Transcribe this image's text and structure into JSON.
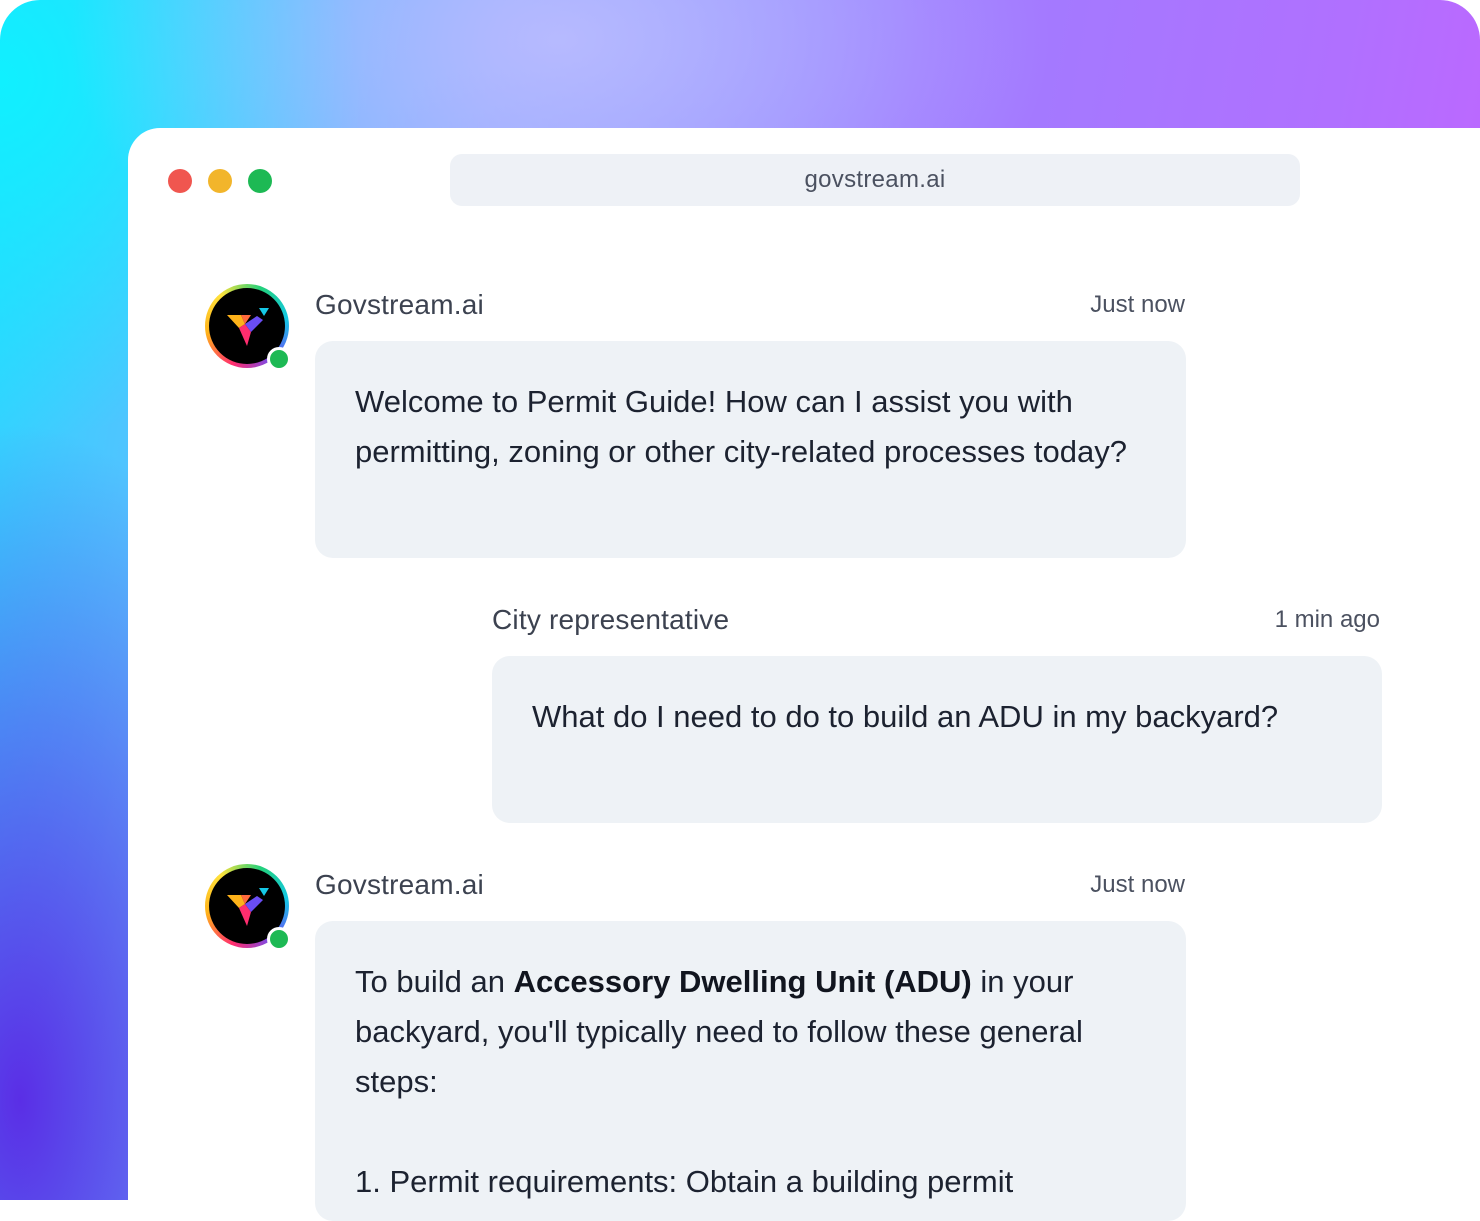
{
  "browser": {
    "url": "govstream.ai"
  },
  "messages": [
    {
      "sender": "Govstream.ai",
      "time": "Just now",
      "text": "Welcome to Permit Guide! How can I assist you with permitting, zoning or other city-related processes today?",
      "online": true
    },
    {
      "sender": "City representative",
      "time": "1 min ago",
      "text": "What do I need to do to build an ADU in my backyard?"
    },
    {
      "sender": "Govstream.ai",
      "time": "Just now",
      "online": true,
      "intro_before": "To build an ",
      "intro_bold": "Accessory Dwelling Unit (ADU)",
      "intro_after": " in your backyard, you'll typically need to follow these general steps:",
      "step_1": "1. Permit requirements: Obtain a building permit"
    }
  ],
  "colors": {
    "online_status": "#1db954",
    "bubble_background": "#eef2f6",
    "window_close": "#f0564f",
    "window_minimize": "#f2b52b",
    "window_maximize": "#1db954"
  }
}
